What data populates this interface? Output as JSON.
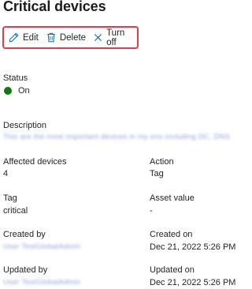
{
  "header": {
    "title": "Critical devices"
  },
  "toolbar": {
    "edit_label": "Edit",
    "delete_label": "Delete",
    "turnoff_label": "Turn off"
  },
  "status": {
    "label": "Status",
    "value": "On",
    "dot_color": "#0e7a0d"
  },
  "description": {
    "label": "Description",
    "value": "This are the most important devices in my env including DC, DNS"
  },
  "details": {
    "affected_devices_label": "Affected devices",
    "affected_devices_value": "4",
    "action_label": "Action",
    "action_value": "Tag",
    "tag_label": "Tag",
    "tag_value": "critical",
    "asset_value_label": "Asset value",
    "asset_value_value": "-",
    "created_by_label": "Created by",
    "created_by_value": "User TestGlobalAdmin",
    "created_on_label": "Created on",
    "created_on_value": "Dec 21, 2022 5:26 PM",
    "updated_by_label": "Updated by",
    "updated_by_value": "User TestGlobalAdmin",
    "updated_on_label": "Updated on",
    "updated_on_value": "Dec 21, 2022 5:26 PM"
  },
  "colors": {
    "highlight_border": "#e23b4c",
    "accent": "#0f6cbd"
  }
}
